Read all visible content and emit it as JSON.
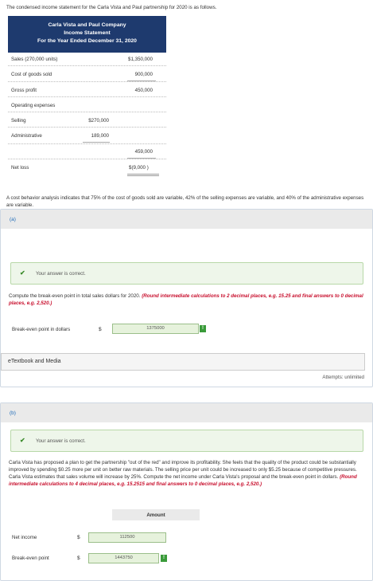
{
  "intro": "The condensed income statement for the Carla Vista and Paul partnership for 2020 is as follows.",
  "statement": {
    "header_line1": "Carla Vista and Paul Company",
    "header_line2": "Income Statement",
    "header_line3": "For the Year Ended December 31, 2020",
    "sales_label": "Sales (270,000 units)",
    "sales_value": "$1,350,000",
    "cogs_label": "Cost of goods sold",
    "cogs_value": "900,000",
    "gross_label": "Gross profit",
    "gross_value": "450,000",
    "opex_label": "Operating expenses",
    "selling_label": "Selling",
    "selling_value": "$270,000",
    "admin_label": "Administrative",
    "admin_value": "189,000",
    "opex_total": "459,000",
    "netloss_label": "Net loss",
    "netloss_value": "$(9,000  )"
  },
  "behavior_text": "A cost behavior analysis indicates that 75% of the cost of goods sold are variable, 42% of the selling expenses are variable, and 40% of the administrative expenses are variable.",
  "part_a": {
    "tag": "(a)",
    "correct_msg": "Your answer is correct.",
    "question": "Compute the break-even point in total sales dollars for 2020.",
    "hint": "(Round intermediate calculations to 2 decimal places, e.g. 15.25 and final answers to 0 decimal places, e.g. 2,520.)",
    "field_label": "Break-even point in dollars",
    "currency": "$",
    "answer": "1375000",
    "etext": "eTextbook and Media",
    "attempts": "Attempts: unlimited"
  },
  "part_b": {
    "tag": "(b)",
    "correct_msg": "Your answer is correct.",
    "question": "Carla Vista has proposed a plan to get the partnership \"out of the red\" and improve its profitability. She feels that the quality of the product could be substantially improved by spending $0.25 more per unit on better raw materials. The selling price per unit could be increased to only $5.25 because of competitive pressures. Carla Vista estimates that sales volume will increase by 25%. Compute the net income under Carla Vista's proposal and the break-even point in dollars.",
    "hint": "(Round intermediate calculations to 4 decimal places, e.g. 15.2515 and final answers to 0 decimal places, e.g. 2,520.)",
    "col_header": "Amount",
    "net_income_label": "Net income",
    "net_income_currency": "$",
    "net_income_value": "112500",
    "bep_label": "Break-even point",
    "bep_currency": "$",
    "bep_value": "1443750"
  },
  "colors": {
    "header_bg": "#1e3a6e",
    "correct_bg": "#eef6ea",
    "check": "#3a8a2a",
    "hint_red": "#c8102e",
    "link_blue": "#1e6bb8"
  }
}
